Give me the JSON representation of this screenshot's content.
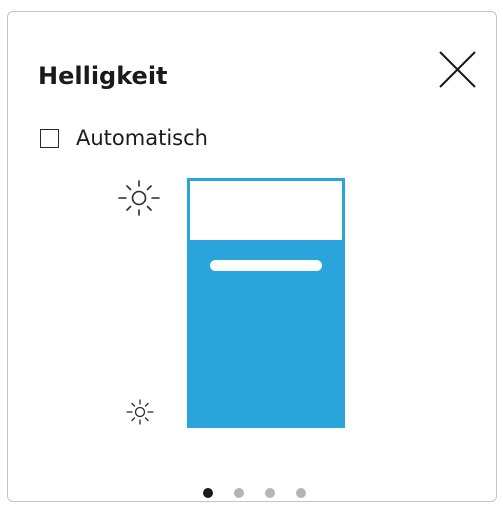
{
  "dialog": {
    "title": "Helligkeit",
    "close_icon": "close-icon"
  },
  "automatic": {
    "label": "Automatisch",
    "checked": false
  },
  "brightness": {
    "level": 0.76,
    "high_icon": "sun-high-icon",
    "low_icon": "sun-low-icon"
  },
  "colors": {
    "accent": "#2aa5db",
    "text": "#1a1a1a",
    "dot_inactive": "#b5b5b5"
  },
  "pagination": {
    "count": 4,
    "active_index": 0
  }
}
